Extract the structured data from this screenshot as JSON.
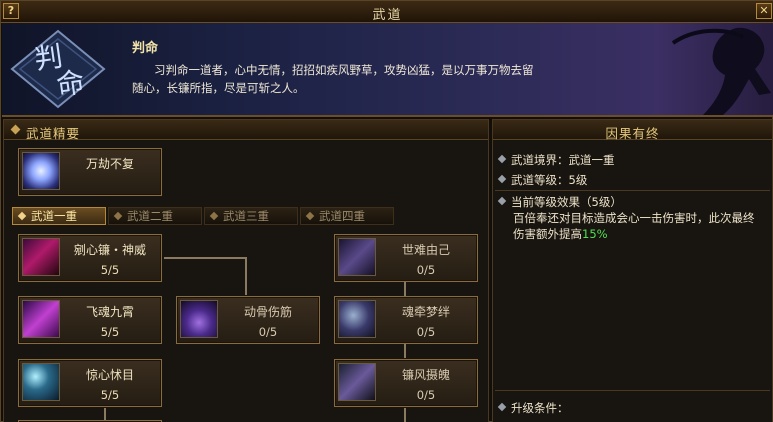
{
  "window": {
    "title": "武道",
    "help_label": "?",
    "close_label": "✕"
  },
  "header": {
    "emblem_text": "判命",
    "name": "判命",
    "desc_line1": "习判命一道者，心中无情，招招如疾风野草，攻势凶猛，是以万事万物去留",
    "desc_line2": "随心，长镰所指，尽是可斩之人。"
  },
  "left": {
    "section_title": "武道精要",
    "essence_skill": {
      "name": "万劫不复",
      "icon": "swirl-skill-icon"
    },
    "tabs": [
      {
        "label": "武道一重",
        "active": true
      },
      {
        "label": "武道二重",
        "active": false
      },
      {
        "label": "武道三重",
        "active": false
      },
      {
        "label": "武道四重",
        "active": false
      }
    ],
    "skills": [
      {
        "name": "剜心镰・神威",
        "level": "5/5",
        "icon": "scythe-skill-icon"
      },
      {
        "name": "飞魂九霄",
        "level": "5/5",
        "icon": "soul-skill-icon"
      },
      {
        "name": "惊心怵目",
        "level": "5/5",
        "icon": "moon-skill-icon"
      },
      {
        "name": "动骨伤筋",
        "level": "0/5",
        "icon": "flame-skill-icon"
      },
      {
        "name": "世难由己",
        "level": "0/5",
        "icon": "shadow-skill-icon"
      },
      {
        "name": "魂牵梦绊",
        "level": "0/5",
        "icon": "spirit-skill-icon"
      },
      {
        "name": "镰风摄魄",
        "level": "0/5",
        "icon": "wind-skill-icon"
      }
    ]
  },
  "right": {
    "section_title": "因果有终",
    "realm": "武道境界：武道一重",
    "level": "武道等级：5级",
    "effect_title": "当前等级效果（5级）",
    "effect_text": "百倍奉还对目标造成会心一击伤害时，此次最终伤害额外提高",
    "effect_value": "15%",
    "upgrade_title": "升级条件："
  },
  "colors": {
    "accent": "#e7c97c",
    "value_green": "#4fe04f",
    "frame_gold": "#8a6c3c"
  }
}
